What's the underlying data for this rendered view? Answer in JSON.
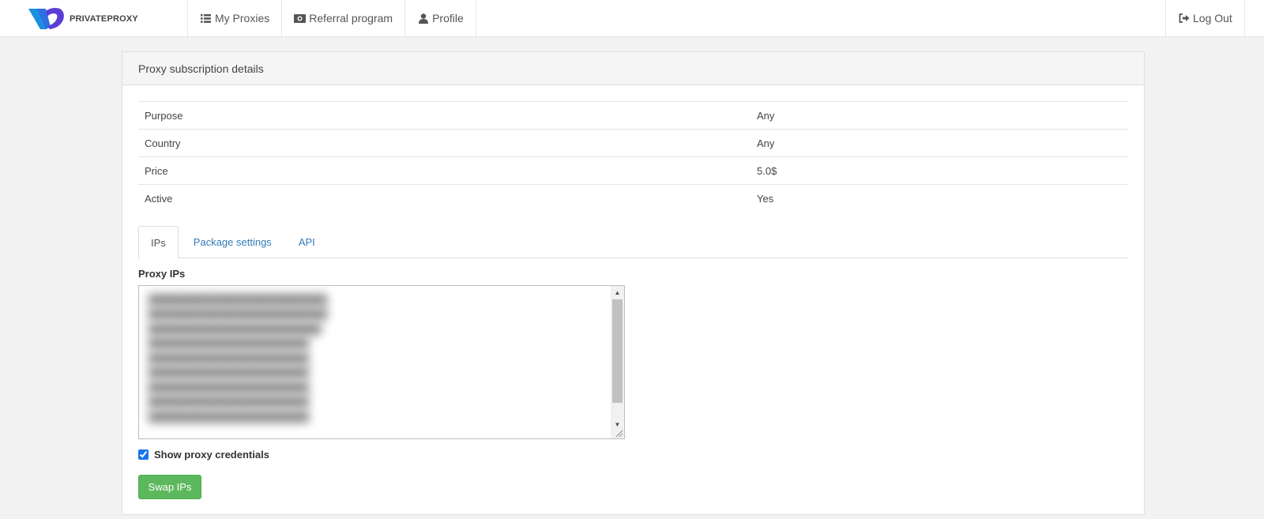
{
  "brand": {
    "name": "PRIVATEPROXY",
    "colors": {
      "blue": "#1a8fe0",
      "purple": "#5a3fd6"
    }
  },
  "nav": {
    "left": [
      {
        "label": "My Proxies",
        "icon": "list-icon"
      },
      {
        "label": "Referral program",
        "icon": "money-icon"
      },
      {
        "label": "Profile",
        "icon": "user-icon"
      }
    ],
    "right": [
      {
        "label": "Log Out",
        "icon": "sign-out-icon"
      }
    ]
  },
  "panel": {
    "title": "Proxy subscription details",
    "details": [
      {
        "label": "Purpose",
        "value": "Any"
      },
      {
        "label": "Country",
        "value": "Any"
      },
      {
        "label": "Price",
        "value": "5.0$"
      },
      {
        "label": "Active",
        "value": "Yes"
      }
    ],
    "tabs": [
      {
        "label": "IPs",
        "active": true
      },
      {
        "label": "Package settings",
        "active": false
      },
      {
        "label": "API",
        "active": false
      }
    ],
    "ips_label": "Proxy IPs",
    "show_credentials_label": "Show proxy credentials",
    "show_credentials_checked": true,
    "swap_button": "Swap IPs"
  },
  "colors": {
    "accent": "#337ab7",
    "success": "#5cb85c"
  }
}
